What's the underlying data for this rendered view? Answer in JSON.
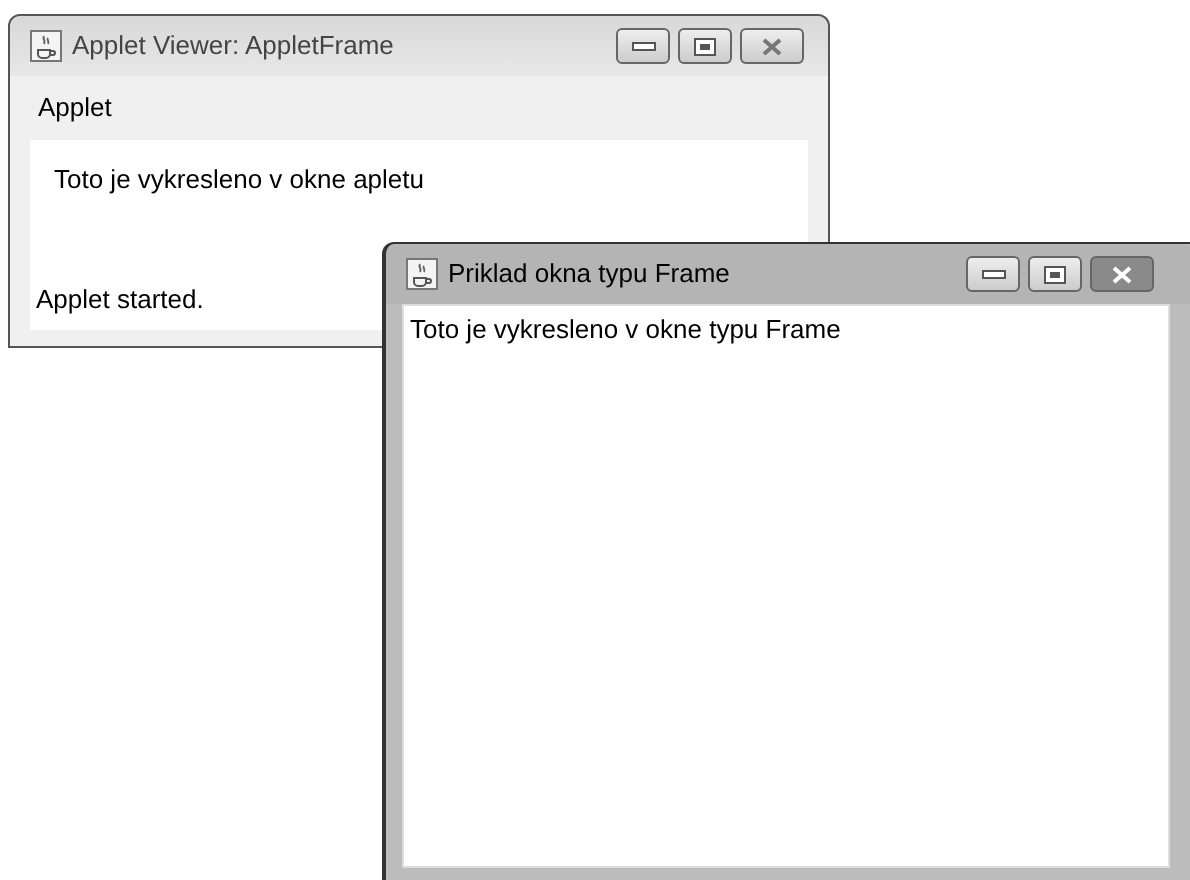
{
  "windows": [
    {
      "title": "Applet Viewer: AppletFrame",
      "active": false,
      "menu": [
        "Applet"
      ],
      "content": "Toto je vykresleno v okne apletu",
      "status_bar": "Applet started."
    },
    {
      "title": "Priklad okna typu Frame",
      "active": true,
      "content": "Toto je vykresleno v okne typu Frame"
    }
  ]
}
